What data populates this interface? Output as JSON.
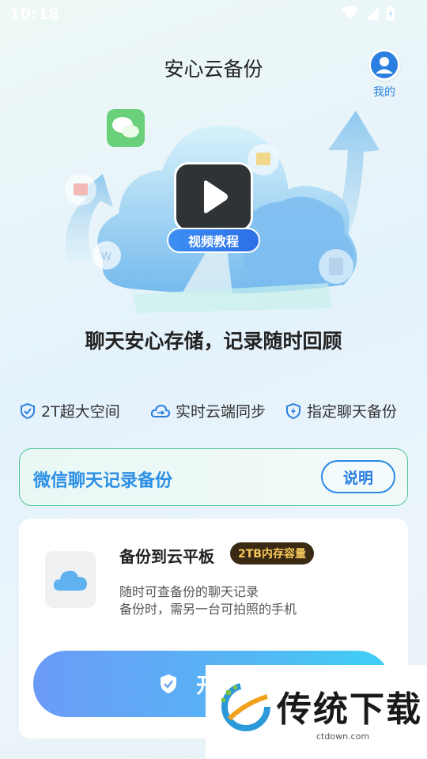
{
  "status_bar": {
    "time": "10:18"
  },
  "header": {
    "title": "安心云备份",
    "me_label": "我的"
  },
  "hero": {
    "video_badge": "视频教程"
  },
  "headline": "聊天安心存储，记录随时回顾",
  "features": [
    {
      "label": "2T超大空间",
      "icon": "shield-check-icon"
    },
    {
      "label": "实时云端同步",
      "icon": "cloud-sync-icon"
    },
    {
      "label": "指定聊天备份",
      "icon": "bolt-shield-icon"
    }
  ],
  "banner": {
    "title": "微信聊天记录备份",
    "button": "说明"
  },
  "card": {
    "title": "备份到云平板",
    "badge": "2TB内存容量",
    "desc1": "随时可查备份的聊天记录",
    "desc2": "备份时，需另一台可拍照的手机",
    "start_label": "开"
  },
  "watermark": {
    "text": "传统下载",
    "url": "ctdown.com"
  },
  "colors": {
    "accent": "#2b7fe0",
    "banner_border": "#4cc49a",
    "badge_bg": "#3a2a14",
    "badge_text": "#f6c85a"
  }
}
